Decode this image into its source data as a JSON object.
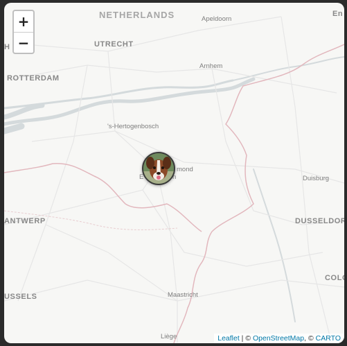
{
  "map": {
    "labels": {
      "netherlands": "NETHERLANDS",
      "utrecht": "UTRECHT",
      "rotterdam": "ROTTERDAM",
      "apeldoorn": "Apeldoorn",
      "arnhem": "Arnhem",
      "hertogenbosch": "'s-Hertogenbosch",
      "helmond": "mond",
      "eindhoven": "E",
      "eindhoven_suffix": "n",
      "duisburg": "Duisburg",
      "antwerp": "ANTWERP",
      "dusseldorf": "DUSSELDORF",
      "brussels": "USSELS",
      "colo": "COLO",
      "maastricht": "Maastricht",
      "liege": "Liège",
      "h_edge": "H",
      "en_edge": "En"
    },
    "colors": {
      "background": "#f7f7f5",
      "border": "#e2b7bd",
      "water": "#d4dadc",
      "road": "#e6e6e6"
    }
  },
  "controls": {
    "zoom_in": "+",
    "zoom_out": "−"
  },
  "marker": {
    "icon": "dog-avatar-icon"
  },
  "attribution": {
    "leaflet": "Leaflet",
    "sep1": " | © ",
    "osm": "OpenStreetMap",
    "sep2": ", © ",
    "carto": "CARTO"
  }
}
